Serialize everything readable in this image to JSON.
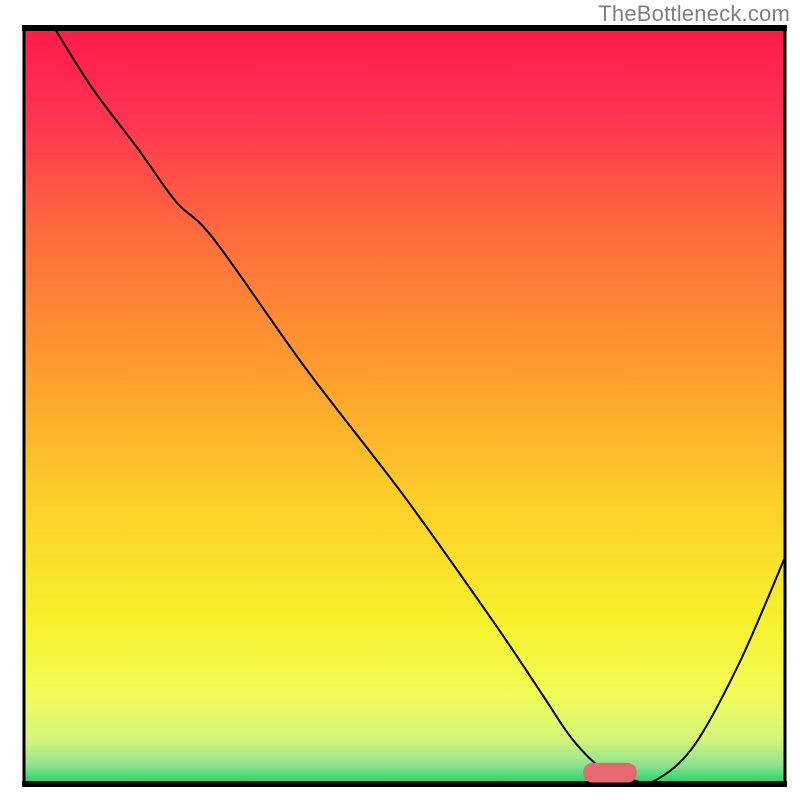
{
  "watermark": "TheBottleneck.com",
  "chart_data": {
    "type": "line",
    "title": "",
    "xlabel": "",
    "ylabel": "",
    "xlim": [
      0,
      100
    ],
    "ylim": [
      0,
      100
    ],
    "background": {
      "type": "vertical_gradient",
      "description": "rainbow red-to-green with thin green band at bottom",
      "stops": [
        {
          "offset": 0.0,
          "color": "#ff1a4c"
        },
        {
          "offset": 0.12,
          "color": "#ff3452"
        },
        {
          "offset": 0.28,
          "color": "#ff6e3c"
        },
        {
          "offset": 0.45,
          "color": "#ff9c2f"
        },
        {
          "offset": 0.62,
          "color": "#fcce29"
        },
        {
          "offset": 0.78,
          "color": "#f7f02b"
        },
        {
          "offset": 0.88,
          "color": "#f2fb57"
        },
        {
          "offset": 0.94,
          "color": "#d6f67a"
        },
        {
          "offset": 0.975,
          "color": "#8de38f"
        },
        {
          "offset": 1.0,
          "color": "#1dd16b"
        }
      ]
    },
    "series": [
      {
        "name": "bottleneck_curve",
        "stroke": "#000000",
        "stroke_width": 2,
        "x": [
          4,
          9,
          15,
          20,
          25,
          37,
          50,
          62,
          68,
          72,
          76,
          80,
          83,
          88,
          94,
          100
        ],
        "y": [
          100,
          92,
          84,
          77,
          72,
          55,
          38,
          21,
          12,
          6,
          2,
          0.5,
          0.5,
          5,
          16,
          30
        ]
      }
    ],
    "marker": {
      "name": "optimal_pill",
      "shape": "rounded_rect",
      "cx": 77,
      "cy": 1.5,
      "w": 7,
      "h": 2.6,
      "fill": "#e46a6f"
    },
    "frame": {
      "stroke": "#000000",
      "stroke_width": 3,
      "bottom_top_width": 6
    }
  }
}
